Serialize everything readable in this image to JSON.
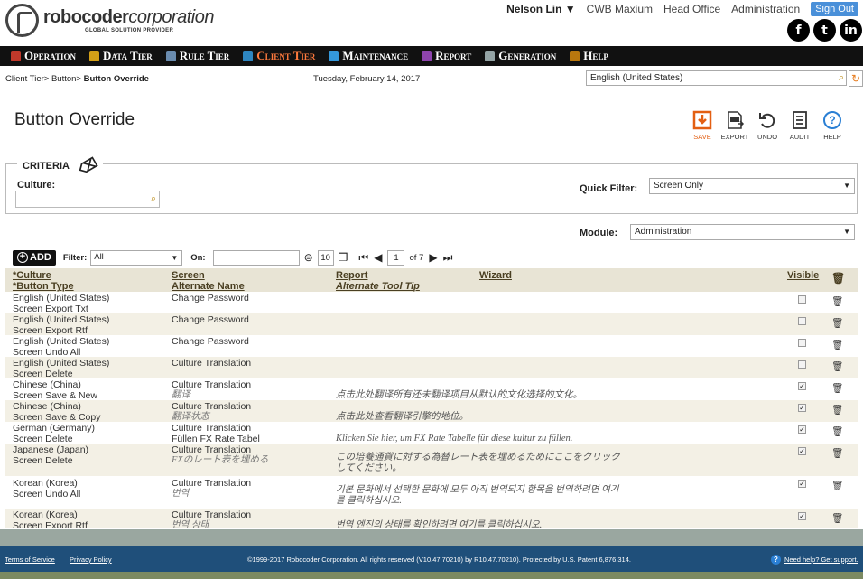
{
  "header": {
    "logo_name_bold": "robocoder",
    "logo_name_italic": "corporation",
    "logo_sub": "GLOBAL SOLUTION PROVIDER",
    "user": "Nelson Lin ▼",
    "links": [
      "CWB Maxium",
      "Head Office",
      "Administration"
    ],
    "signout": "Sign Out",
    "social": [
      "f",
      "t",
      "in"
    ]
  },
  "mainnav": [
    {
      "label": "Operation",
      "icon_color": "#c0392b",
      "active": false
    },
    {
      "label": "Data Tier",
      "icon_color": "#d4a017",
      "active": false
    },
    {
      "label": "Rule Tier",
      "icon_color": "#6a8caf",
      "active": false
    },
    {
      "label": "Client Tier",
      "icon_color": "#2e86c1",
      "active": true
    },
    {
      "label": "Maintenance",
      "icon_color": "#3498db",
      "active": false
    },
    {
      "label": "Report",
      "icon_color": "#8e44ad",
      "active": false
    },
    {
      "label": "Generation",
      "icon_color": "#95a5a6",
      "active": false
    },
    {
      "label": "Help",
      "icon_color": "#b9770e",
      "active": false
    }
  ],
  "breadcrumb": {
    "path": "Client Tier> Button> ",
    "current": "Button Override"
  },
  "date": "Tuesday, February 14, 2017",
  "language": "English (United States)",
  "page_title": "Button Override",
  "toolbar": {
    "save": "SAVE",
    "export": "EXPORT",
    "undo": "UNDO",
    "audit": "AUDIT",
    "help": "HELP"
  },
  "criteria": {
    "legend": "CRITERIA",
    "culture_label": "Culture:",
    "culture_value": "",
    "quick_filter_label": "Quick Filter:",
    "quick_filter_value": "Screen Only",
    "module_label": "Module:",
    "module_value": "Administration"
  },
  "gridbar": {
    "add": "ADD",
    "filter_label": "Filter:",
    "filter_value": "All",
    "on_label": "On:",
    "on_value": "",
    "page_size": "10",
    "page": "1",
    "of": "of 7"
  },
  "grid_headers": {
    "culture": "*Culture",
    "button_type": "*Button Type",
    "screen": "Screen",
    "alternate_name": "Alternate Name",
    "report": "Report",
    "alternate_tool_tip": "Alternate Tool Tip",
    "wizard": "Wizard",
    "visible": "Visible"
  },
  "rows": [
    {
      "culture": "English (United States)",
      "button_type": "Screen Export Txt",
      "screen": "Change Password",
      "alt_name": "",
      "tip": "",
      "visible": false
    },
    {
      "culture": "English (United States)",
      "button_type": "Screen Export Rtf",
      "screen": "Change Password",
      "alt_name": "",
      "tip": "",
      "visible": false
    },
    {
      "culture": "English (United States)",
      "button_type": "Screen Undo All",
      "screen": "Change Password",
      "alt_name": "",
      "tip": "",
      "visible": false
    },
    {
      "culture": "English (United States)",
      "button_type": "Screen Delete",
      "screen": "Culture Translation",
      "alt_name": "",
      "tip": "",
      "visible": false
    },
    {
      "culture": "Chinese (China)",
      "button_type": "Screen Save & New",
      "screen": "Culture Translation",
      "alt_name": "翻译",
      "tip": "点击此处翻译所有还未翻译项目从默认的文化选择的文化。",
      "visible": true
    },
    {
      "culture": "Chinese (China)",
      "button_type": "Screen Save & Copy",
      "screen": "Culture Translation",
      "alt_name": "翻译状态",
      "tip": "点击此处查看翻译引擎的地位。",
      "visible": true
    },
    {
      "culture": "German (Germany)",
      "button_type": "Screen Delete",
      "screen": "Culture Translation",
      "alt_name": "Füllen FX Rate Tabel",
      "tip": "Klicken Sie hier, um FX Rate Tabelle für diese kultur zu füllen.",
      "visible": true
    },
    {
      "culture": "Japanese (Japan)",
      "button_type": "Screen Delete",
      "screen": "Culture Translation",
      "alt_name": "FXのレート表を埋める",
      "tip": "この培養通貨に対する為替レート表を埋めるためにここをクリックしてください。",
      "visible": true
    },
    {
      "culture": "Korean (Korea)",
      "button_type": "Screen Undo All",
      "screen": "Culture Translation",
      "alt_name": "번역",
      "tip": "기본 문화에서 선택한 문화에 모두 아직 번역되지 항목을 번역하려면 여기를 클릭하십시오.",
      "visible": true
    },
    {
      "culture": "Korean (Korea)",
      "button_type": "Screen Export Rtf",
      "screen": "Culture Translation",
      "alt_name": "번역 상태",
      "tip": "번역 엔진의 상태를 확인하려면 여기를 클릭하십시오.",
      "visible": true
    }
  ],
  "footer": {
    "terms": "Terms of Service",
    "privacy": "Privacy Policy",
    "copyright": "©1999-2017 Robocoder Corporation. All rights reserved (V10.47.70210) by R10.47.70210). Protected by U.S. Patent 6,876,314.",
    "help": "Need help? Get support."
  }
}
